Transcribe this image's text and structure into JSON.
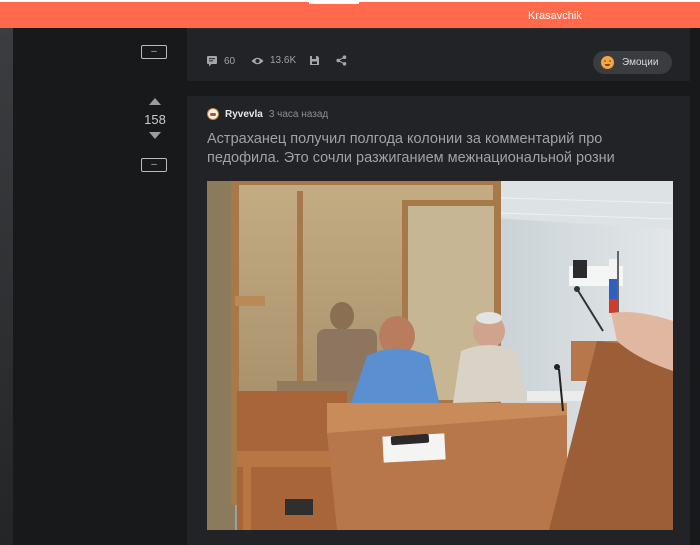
{
  "header": {
    "username": "Krasavchik"
  },
  "controls": {
    "collapse_label": "–"
  },
  "previous_post": {
    "comments_count": "60",
    "views_count": "13.6K",
    "emotions_label": "Эмоции"
  },
  "post": {
    "rating": "158",
    "author": "Ryvevla",
    "time": "3 часа назад",
    "title": "Астраханец получил полгода колонии за комментарий про педофила. Это сочли разжиганием межнациональной розни"
  },
  "icons": [
    "comment-icon",
    "eye-icon",
    "save-icon",
    "share-icon",
    "arrow-up-icon",
    "arrow-down-icon"
  ],
  "colors": {
    "accent": "#ff6a4d",
    "background": "#18191b",
    "card": "#212326"
  }
}
